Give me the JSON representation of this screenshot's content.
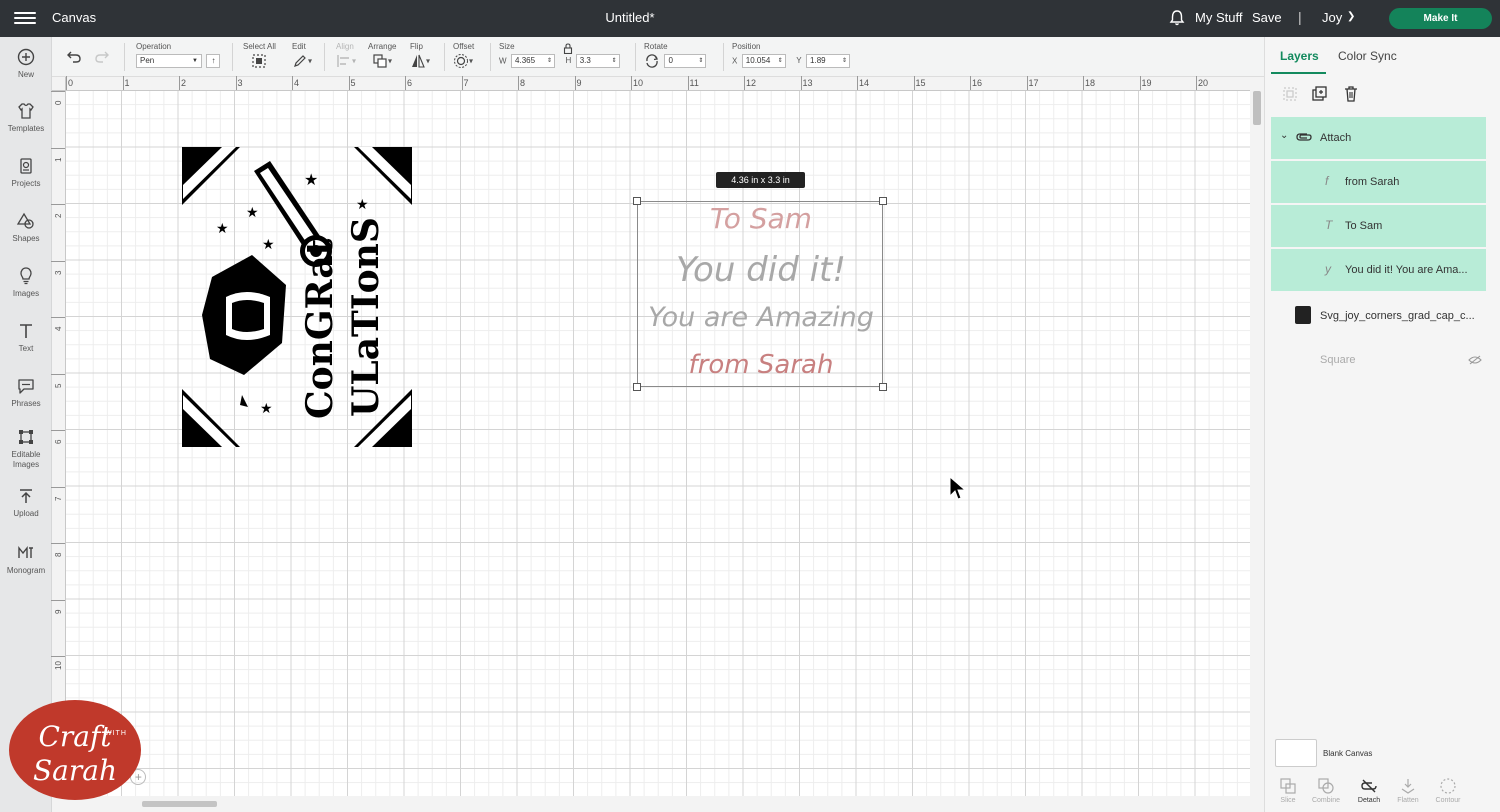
{
  "topbar": {
    "app_title": "Canvas",
    "doc_title": "Untitled*",
    "my_stuff": "My Stuff",
    "save": "Save",
    "separator": "|",
    "machine": "Joy",
    "make_it": "Make It"
  },
  "leftrail": {
    "items": [
      {
        "label": "New",
        "icon": "plus-circle-icon"
      },
      {
        "label": "Templates",
        "icon": "shirt-icon"
      },
      {
        "label": "Projects",
        "icon": "projects-icon"
      },
      {
        "label": "Shapes",
        "icon": "shapes-icon"
      },
      {
        "label": "Images",
        "icon": "lightbulb-icon"
      },
      {
        "label": "Text",
        "icon": "text-icon"
      },
      {
        "label": "Phrases",
        "icon": "speech-bubble-icon"
      },
      {
        "label": "Editable Images",
        "icon": "editable-images-icon"
      },
      {
        "label": "Upload",
        "icon": "upload-icon"
      },
      {
        "label": "Monogram",
        "icon": "monogram-icon"
      }
    ]
  },
  "toolbar": {
    "operation_label": "Operation",
    "operation_value": "Pen",
    "select_all_label": "Select All",
    "edit_label": "Edit",
    "align_label": "Align",
    "arrange_label": "Arrange",
    "flip_label": "Flip",
    "offset_label": "Offset",
    "size_label": "Size",
    "w_label": "W",
    "w_value": "4.365",
    "h_label": "H",
    "h_value": "3.3",
    "rotate_label": "Rotate",
    "rotate_value": "0",
    "position_label": "Position",
    "x_label": "X",
    "x_value": "10.054",
    "y_label": "Y",
    "y_value": "1.89"
  },
  "rulers": {
    "top": [
      "0",
      "1",
      "2",
      "3",
      "4",
      "5",
      "6",
      "7",
      "8",
      "9",
      "10",
      "11",
      "12",
      "13",
      "14",
      "15",
      "16",
      "17",
      "18",
      "19",
      "20"
    ],
    "left": [
      "0",
      "1",
      "2",
      "3",
      "4",
      "5",
      "6",
      "7",
      "8",
      "9",
      "10"
    ]
  },
  "canvas": {
    "size_tooltip": "4.36  in x 3.3  in",
    "text_lines": [
      {
        "text": "To Sam",
        "color": "#d4a0a0"
      },
      {
        "text": "You did it!",
        "color": "#a8a8a8"
      },
      {
        "text": "You are Amazing",
        "color": "#a8a8a8"
      },
      {
        "text": "from Sarah",
        "color": "#c88080"
      }
    ],
    "design_text_1": "ConGRat",
    "design_text_2": "ULaTIonS",
    "zoom": "%"
  },
  "rightpanel": {
    "tab_layers": "Layers",
    "tab_colorsync": "Color Sync",
    "layers": [
      {
        "name": "Attach",
        "selected": true
      },
      {
        "name": "from Sarah",
        "selected": true
      },
      {
        "name": "To Sam",
        "selected": true
      },
      {
        "name": "You did it! You are Ama...",
        "selected": true
      },
      {
        "name": "Svg_joy_corners_grad_cap_c...",
        "selected": false
      },
      {
        "name": "Square",
        "selected": false
      }
    ],
    "blank_canvas": "Blank Canvas",
    "actions": [
      "Slice",
      "Combine",
      "Detach",
      "Flatten",
      "Contour"
    ]
  },
  "logo": {
    "line1": "Craft",
    "with": "WITH",
    "line2": "Sarah"
  },
  "colors": {
    "topbar": "#2f3337",
    "accent": "#14835a",
    "selected_layer": "#b8ecd7"
  }
}
